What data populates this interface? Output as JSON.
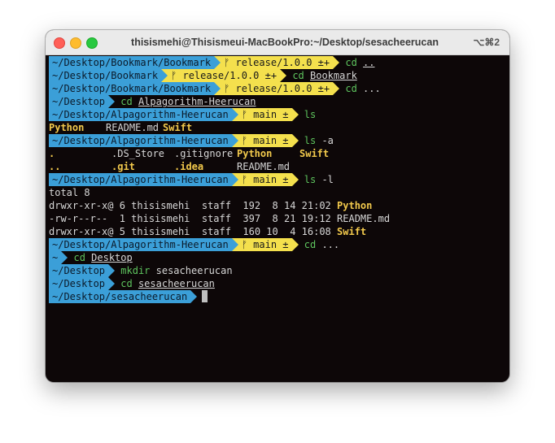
{
  "window": {
    "title": "thisismehi@Thisismeui-MacBookPro:~/Desktop/sesacheerucan",
    "shortcut": "⌥⌘2"
  },
  "lines": [
    {
      "path": "~/Desktop/Bookmark/Bookmark",
      "branch": "ᚠ release/1.0.0 ±+",
      "cmd": "cd",
      "arg": ".."
    },
    {
      "path": "~/Desktop/Bookmark",
      "branch": "ᚠ release/1.0.0 ±+",
      "cmd": "cd",
      "arg": "Bookmark"
    },
    {
      "path": "~/Desktop/Bookmark/Bookmark",
      "branch": "ᚠ release/1.0.0 ±+",
      "cmd": "cd",
      "arg": "..."
    },
    {
      "path": "~/Desktop",
      "cmd": "cd",
      "arg": "Alpagorithm-Heerucan"
    },
    {
      "path": "~/Desktop/Alpagorithm-Heerucan",
      "branch": "ᚠ main ±",
      "cmd": "ls",
      "arg": ""
    },
    {
      "output": [
        "Python",
        "README.md",
        "Swift"
      ]
    },
    {
      "path": "~/Desktop/Alpagorithm-Heerucan",
      "branch": "ᚠ main ±",
      "cmd": "ls",
      "arg": "-a"
    },
    {
      "output_a1": [
        ".",
        ".DS_Store",
        ".gitignore",
        "Python",
        "Swift"
      ]
    },
    {
      "output_a2": [
        "..",
        ".git",
        ".idea",
        "README.md"
      ]
    },
    {
      "path": "~/Desktop/Alpagorithm-Heerucan",
      "branch": "ᚠ main ±",
      "cmd": "ls",
      "arg": "-l"
    },
    {
      "total": "total 8"
    },
    {
      "perm": "drwxr-xr-x@ 6 thisismehi  staff  192  8 14 21:02",
      "name": "Python"
    },
    {
      "perm": "-rw-r--r--  1 thisismehi  staff  397  8 21 19:12",
      "name": "README.md"
    },
    {
      "perm": "drwxr-xr-x@ 5 thisismehi  staff  160 10  4 16:08",
      "name": "Swift"
    },
    {
      "path": "~/Desktop/Alpagorithm-Heerucan",
      "branch": "ᚠ main ±",
      "cmd": "cd",
      "arg": "..."
    },
    {
      "path": "~",
      "cmd": "cd",
      "arg": "Desktop"
    },
    {
      "path": "~/Desktop",
      "cmd": "mkdir",
      "arg": "sesacheerucan"
    },
    {
      "path": "~/Desktop",
      "cmd": "cd",
      "arg": "sesacheerucan"
    },
    {
      "path": "~/Desktop/sesacheerucan"
    }
  ],
  "colors": {
    "path_bg": "#3b9fd8",
    "branch_bg": "#f4e04d",
    "command": "#5ec45e",
    "directory": "#f2c94c",
    "terminal_bg": "#0d0708"
  }
}
